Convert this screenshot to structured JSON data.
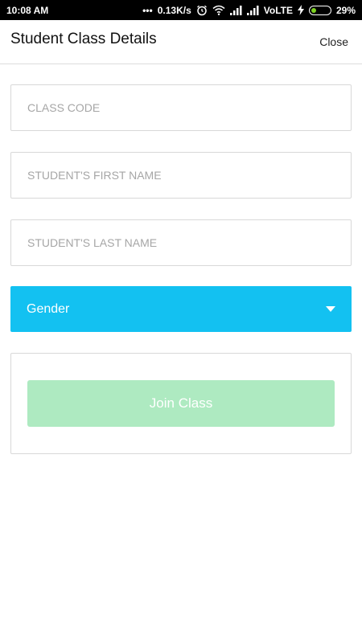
{
  "status_bar": {
    "time": "10:08 AM",
    "network_speed": "0.13K/s",
    "carrier": "VoLTE",
    "battery_percent": "29%",
    "battery_level": 0.29,
    "icons": [
      "dots-icon",
      "alarm-icon",
      "wifi-icon",
      "signal-icon",
      "signal-icon",
      "charging-icon",
      "battery-icon"
    ]
  },
  "header": {
    "title": "Student Class Details",
    "close_label": "Close"
  },
  "form": {
    "class_code_placeholder": "CLASS CODE",
    "first_name_placeholder": "STUDENT'S FIRST NAME",
    "last_name_placeholder": "STUDENT'S LAST NAME",
    "gender_label": "Gender",
    "join_label": "Join Class"
  },
  "colors": {
    "accent": "#13c1f1",
    "join_button": "#aeeac1",
    "battery_fill": "#7ed321"
  }
}
